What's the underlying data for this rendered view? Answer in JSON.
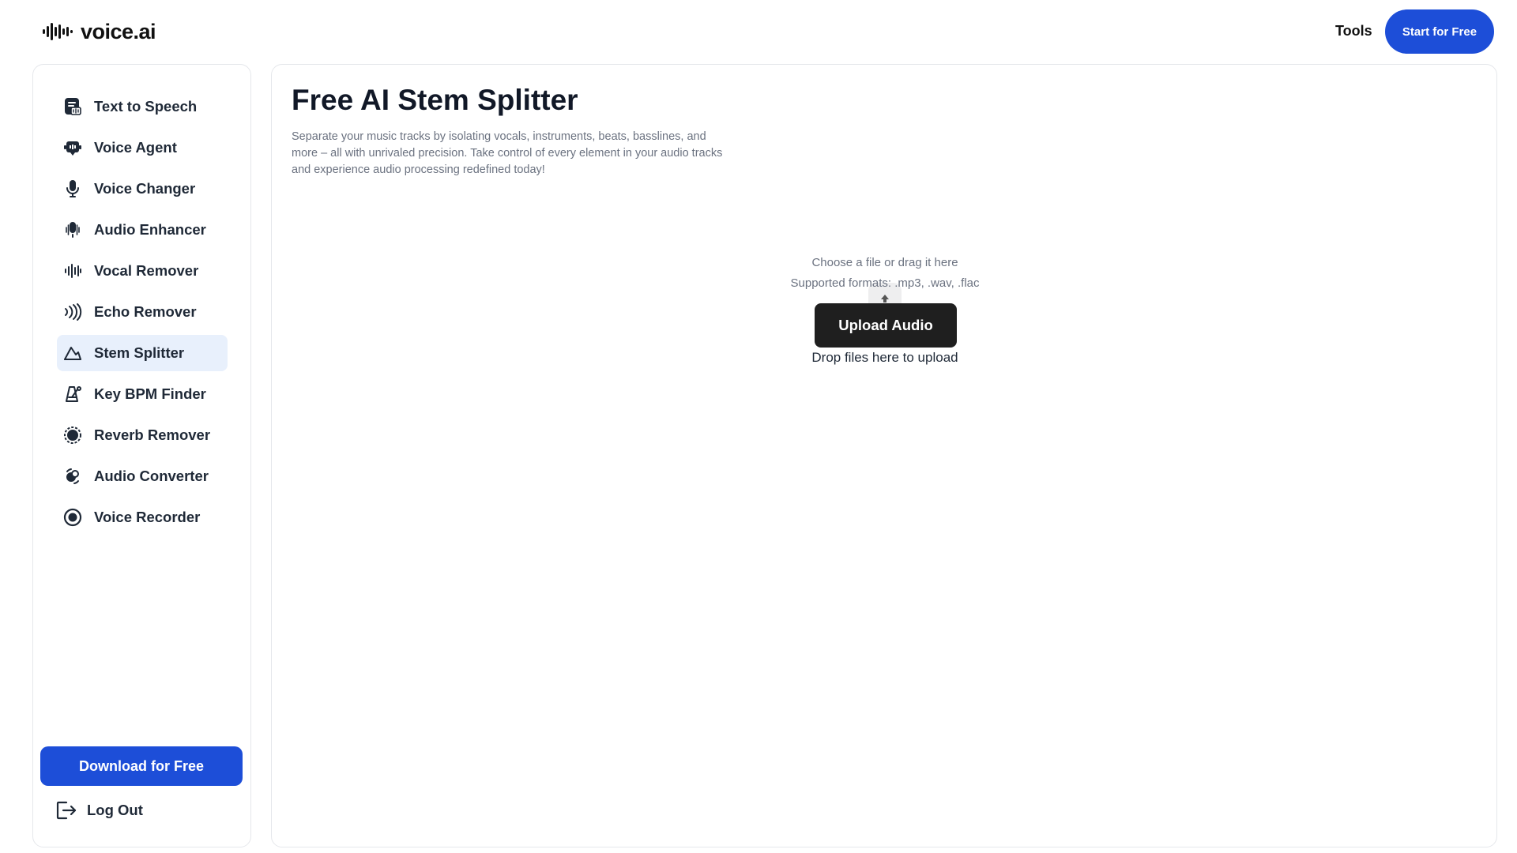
{
  "brand": {
    "name": "voice.ai"
  },
  "header": {
    "tools_label": "Tools",
    "cta_label": "Start for Free"
  },
  "colors": {
    "accent": "#1d4ed8",
    "active_bg": "#e8f0fc",
    "dark_button": "#1f1f1f",
    "muted_text": "#6b7280"
  },
  "sidebar": {
    "items": [
      {
        "label": "Text to Speech",
        "icon": "text-to-speech-icon",
        "active": false
      },
      {
        "label": "Voice Agent",
        "icon": "voice-agent-icon",
        "active": false
      },
      {
        "label": "Voice Changer",
        "icon": "microphone-icon",
        "active": false
      },
      {
        "label": "Audio Enhancer",
        "icon": "audio-enhancer-icon",
        "active": false
      },
      {
        "label": "Vocal Remover",
        "icon": "waveform-icon",
        "active": false
      },
      {
        "label": "Echo Remover",
        "icon": "echo-icon",
        "active": false
      },
      {
        "label": "Stem Splitter",
        "icon": "stem-splitter-icon",
        "active": true
      },
      {
        "label": "Key BPM Finder",
        "icon": "metronome-icon",
        "active": false
      },
      {
        "label": "Reverb Remover",
        "icon": "reverb-icon",
        "active": false
      },
      {
        "label": "Audio Converter",
        "icon": "convert-icon",
        "active": false
      },
      {
        "label": "Voice Recorder",
        "icon": "record-icon",
        "active": false
      }
    ],
    "download_label": "Download for Free",
    "logout_label": "Log Out"
  },
  "main": {
    "title": "Free AI Stem Splitter",
    "description": "Separate your music tracks by isolating vocals, instruments, beats, basslines, and more – all with unrivaled precision. Take control of every element in your audio tracks and experience audio processing redefined today!",
    "upload": {
      "hint": "Choose a file or drag it here",
      "formats": "Supported formats: .mp3, .wav, .flac",
      "button_label": "Upload Audio",
      "drop_text": "Drop files here to upload"
    }
  }
}
